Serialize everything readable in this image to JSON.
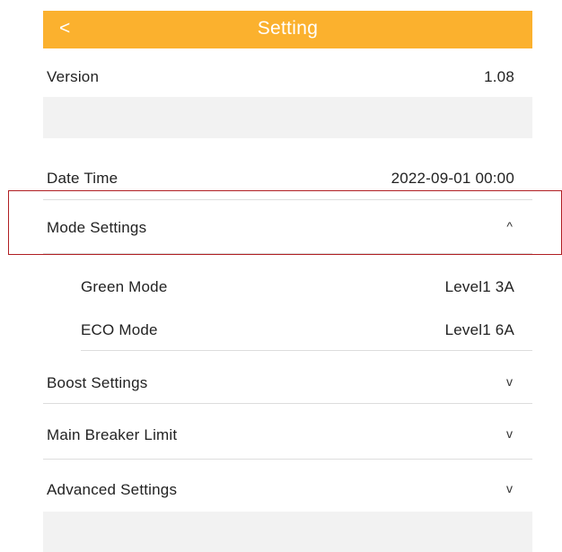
{
  "header": {
    "back_label": "<",
    "title": "Setting"
  },
  "version": {
    "label": "Version",
    "value": "1.08"
  },
  "date_time": {
    "label": "Date Time",
    "value": "2022-09-01 00:00"
  },
  "mode_settings": {
    "label": "Mode Settings",
    "chevron": "^",
    "expanded": true,
    "items": [
      {
        "label": "Green Mode",
        "value": "Level1 3A"
      },
      {
        "label": "ECO Mode",
        "value": "Level1 6A"
      }
    ]
  },
  "boost_settings": {
    "label": "Boost Settings",
    "chevron": "v"
  },
  "main_breaker_limit": {
    "label": "Main Breaker Limit",
    "chevron": "v"
  },
  "advanced_settings": {
    "label": "Advanced Settings",
    "chevron": "v"
  },
  "colors": {
    "accent": "#fbb12e",
    "highlight_border": "#b01e22",
    "band": "#f2f2f2",
    "divider": "#dddddd"
  }
}
